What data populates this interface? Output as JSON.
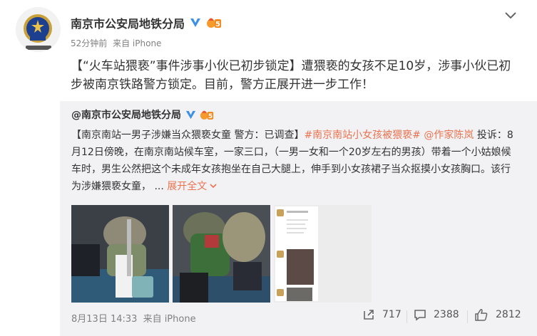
{
  "post": {
    "author": "南京市公安局地铁分局",
    "time": "52分钟前",
    "source": "来自 iPhone",
    "text": "【“火车站猥亵”事件涉事小伙已初步锁定】遭猥亵的女孩不足10岁，涉事小伙已初步被南京铁路警方锁定。目前，警方正展开进一步工作！",
    "level": "5"
  },
  "repost": {
    "author": "@南京市公安局地铁分局",
    "level": "5",
    "text_lead": "【南京南站一男子涉嫌当众猥亵女童 警方：已调查】",
    "hashtag": "#南京南站小女孩被猥亵#",
    "mention": "@作家陈岚",
    "text_body": " 投诉：8月12日傍晚，在南京南站候车室，一家三口，（一男一女和一个20岁左右的男孩）带着一个小姑娘候车时，男生公然把这个未成年女孩抱坐在自己大腿上，伸手到小女孩裙子当众抠摸小女孩胸口。该行为涉嫌猥亵女童， ... ",
    "expand_label": "展开全文",
    "expand_icon": "chevron-down-icon",
    "time": "8月13日 14:33",
    "source": "来自 iPhone",
    "reposts": "717",
    "comments": "2388",
    "likes": "2812"
  },
  "colors": {
    "accent": "#eb7350",
    "verified": "#3c91e6",
    "repost_bg": "#f2f2f5",
    "meta_text": "#808080"
  },
  "icons": {
    "menu": "chevron-down-icon",
    "verified": "verified-v-icon",
    "level": "level-badge-icon",
    "repost": "repost-icon",
    "comment": "comment-icon",
    "like": "thumbs-up-icon"
  }
}
